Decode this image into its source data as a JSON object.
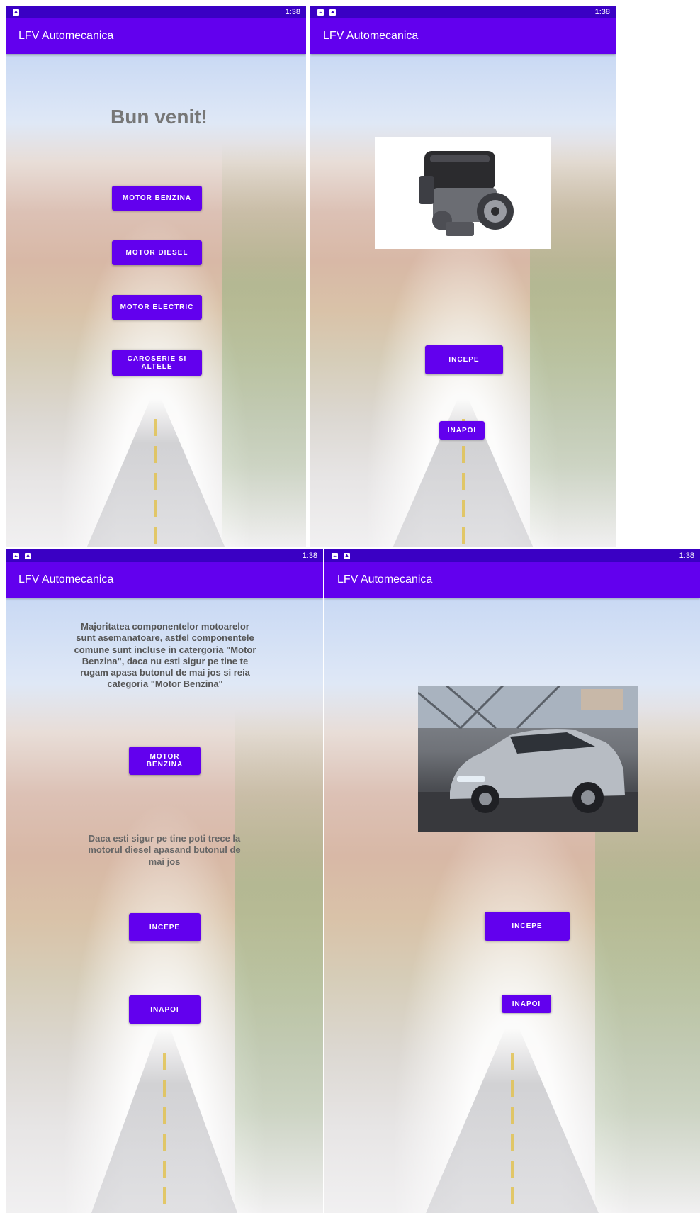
{
  "app": {
    "title": "LFV Automecanica"
  },
  "status": {
    "time": "1:38"
  },
  "screens": {
    "home": {
      "welcome": "Bun venit!",
      "buttons": [
        "MOTOR BENZINA",
        "MOTOR DIESEL",
        "MOTOR ELECTRIC",
        "CAROSERIE SI ALTELE"
      ]
    },
    "engine": {
      "start_label": "INCEPE",
      "back_label": "INAPOI"
    },
    "diesel": {
      "text1": "Majoritatea componentelor motoarelor sunt asemanatoare, astfel componentele comune sunt incluse in catergoria \"Motor Benzina\", daca nu esti sigur pe tine te rugam apasa butonul de mai jos si reia categoria \"Motor Benzina\"",
      "benzina_label": "MOTOR BENZINA",
      "text2": "Daca esti sigur pe tine poti trece la motorul diesel apasand butonul de mai jos",
      "start_label": "INCEPE",
      "back_label": "INAPOI"
    },
    "body": {
      "start_label": "INCEPE",
      "back_label": "INAPOI"
    }
  },
  "colors": {
    "primary": "#6200ee",
    "status_bar": "#3a00c4"
  },
  "icons": [
    "notification-icon",
    "photo-icon",
    "engine-image",
    "car-image"
  ]
}
